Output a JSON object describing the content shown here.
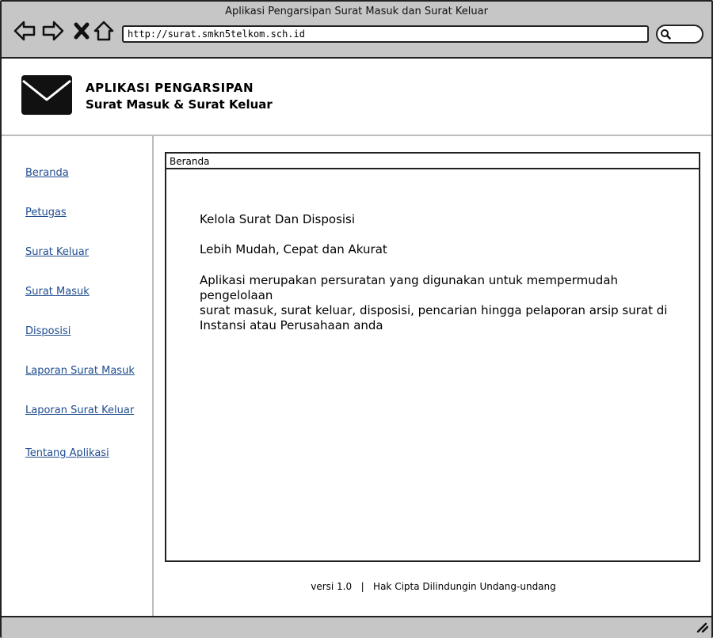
{
  "window": {
    "title": "Aplikasi Pengarsipan Surat Masuk dan Surat Keluar",
    "url": "http://surat.smkn5telkom.sch.id"
  },
  "header": {
    "title": "APLIKASI PENGARSIPAN",
    "subtitle": "Surat Masuk & Surat Keluar",
    "logo_icon": "envelope-icon"
  },
  "sidebar": {
    "items": [
      {
        "label": "Beranda"
      },
      {
        "label": "Petugas"
      },
      {
        "label": "Surat Keluar"
      },
      {
        "label": "Surat Masuk"
      },
      {
        "label": "Disposisi"
      },
      {
        "label": "Laporan Surat Masuk"
      },
      {
        "label": "Laporan Surat Keluar"
      },
      {
        "label": "Tentang Aplikasi"
      }
    ]
  },
  "main": {
    "tab_label": "Beranda",
    "heading": "Kelola Surat Dan Disposisi",
    "tagline": "Lebih Mudah, Cepat dan Akurat",
    "description_lines": [
      "Aplikasi merupakan persuratan yang digunakan untuk mempermudah pengelolaan",
      "surat masuk, surat keluar, disposisi, pencarian hingga pelaporan arsip surat di",
      "Instansi atau Perusahaan anda"
    ]
  },
  "footer": {
    "text": "versi 1.0   |   Hak Cipta Dilindungin Undang-undang"
  },
  "colors": {
    "chrome": "#c6c6c6",
    "link": "#1f4c8f",
    "border": "#222222"
  }
}
